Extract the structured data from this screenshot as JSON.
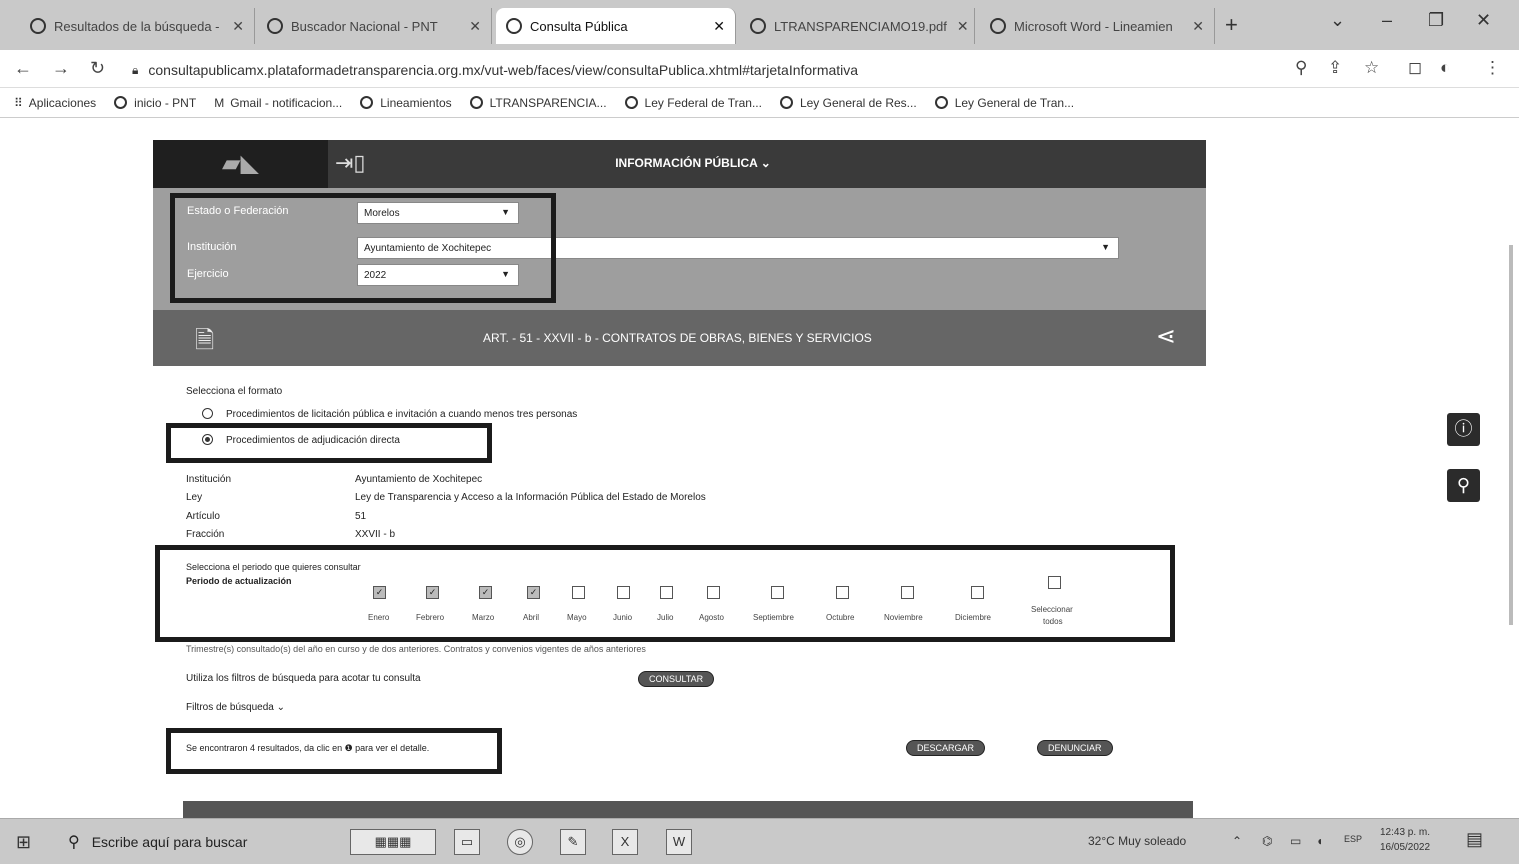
{
  "browser": {
    "tabs": [
      {
        "label": "Resultados de la búsqueda - ",
        "icon": "mail-icon"
      },
      {
        "label": "Buscador Nacional - PNT",
        "icon": "pnt-icon"
      },
      {
        "label": "Consulta Pública",
        "icon": "globe-icon"
      },
      {
        "label": "LTRANSPARENCIAMO19.pdf",
        "icon": "globe-icon"
      },
      {
        "label": "Microsoft Word - Lineamien",
        "icon": "globe-icon"
      }
    ],
    "url": "consultapublicamx.plataformadetransparencia.org.mx/vut-web/faces/view/consultaPublica.xhtml#tarjetaInformativa",
    "bookmarks": [
      "Aplicaciones",
      "inicio - PNT",
      "Gmail - notificacion...",
      "Lineamientos",
      "LTRANSPARENCIA...",
      "Ley Federal de Tran...",
      "Ley General de Res...",
      "Ley General de Tran..."
    ]
  },
  "header": {
    "menu_label": "INFORMACIÓN PÚBLICA ⌄"
  },
  "filters": {
    "estado_label": "Estado o Federación",
    "estado_value": "Morelos",
    "institucion_label": "Institución",
    "institucion_value": "Ayuntamiento de Xochitepec",
    "ejercicio_label": "Ejercicio",
    "ejercicio_value": "2022"
  },
  "section": {
    "title": "ART. - 51 - XXVII - b - CONTRATOS DE OBRAS, BIENES Y SERVICIOS"
  },
  "format": {
    "heading": "Selecciona el formato",
    "options": [
      {
        "label": "Procedimientos de licitación pública e invitación a cuando menos tres personas",
        "selected": false
      },
      {
        "label": "Procedimientos de adjudicación directa",
        "selected": true
      }
    ]
  },
  "details": {
    "institucion_label": "Institución",
    "institucion_value": "Ayuntamiento de Xochitepec",
    "ley_label": "Ley",
    "ley_value": "Ley de Transparencia y Acceso a la Información Pública del Estado de Morelos",
    "articulo_label": "Artículo",
    "articulo_value": "51",
    "fraccion_label": "Fracción",
    "fraccion_value": "XXVII - b"
  },
  "period": {
    "heading": "Selecciona el periodo que quieres consultar",
    "label": "Periodo de actualización",
    "months": [
      {
        "name": "Enero",
        "checked": true
      },
      {
        "name": "Febrero",
        "checked": true
      },
      {
        "name": "Marzo",
        "checked": true
      },
      {
        "name": "Abril",
        "checked": true
      },
      {
        "name": "Mayo",
        "checked": false
      },
      {
        "name": "Junio",
        "checked": false
      },
      {
        "name": "Julio",
        "checked": false
      },
      {
        "name": "Agosto",
        "checked": false
      },
      {
        "name": "Septiembre",
        "checked": false
      },
      {
        "name": "Octubre",
        "checked": false
      },
      {
        "name": "Noviembre",
        "checked": false
      },
      {
        "name": "Diciembre",
        "checked": false
      }
    ],
    "select_all_1": "Seleccionar",
    "select_all_2": "todos",
    "note": "Trimestre(s) consultado(s) del año en curso y de dos anteriores. Contratos y convenios vigentes de años anteriores"
  },
  "search": {
    "hint": "Utiliza los filtros de búsqueda para acotar tu consulta",
    "button": "CONSULTAR",
    "filters_toggle": "Filtros de búsqueda ⌄"
  },
  "results": {
    "text": "Se encontraron 4 resultados, da clic en ❶ para ver el detalle.",
    "download": "DESCARGAR",
    "report": "DENUNCIAR"
  },
  "taskbar": {
    "search_placeholder": "Escribe aquí para buscar",
    "weather": "32°C  Muy soleado",
    "lang": "ESP",
    "time": "12:43 p. m.",
    "date": "16/05/2022"
  }
}
